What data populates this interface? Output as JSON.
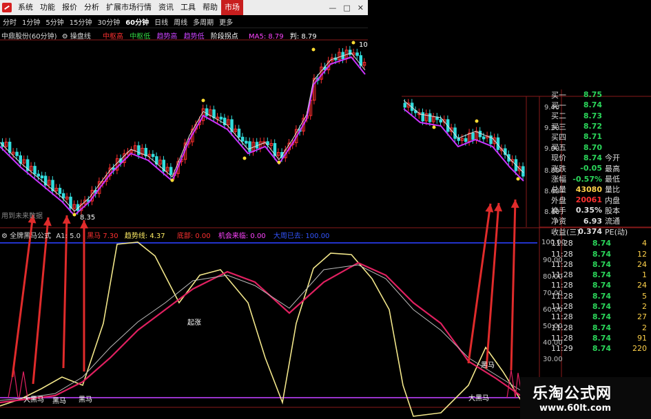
{
  "menubar": {
    "items": [
      "系统",
      "功能",
      "报价",
      "分析",
      "扩展市场行情",
      "资讯",
      "工具",
      "帮助",
      "市场"
    ],
    "active": "市场",
    "window_buttons": [
      "—",
      "□",
      "✕"
    ]
  },
  "periodbar": {
    "tabs": [
      "分时",
      "1分钟",
      "5分钟",
      "15分钟",
      "30分钟",
      "60分钟",
      "日线",
      "周线",
      "多周期",
      "更多"
    ],
    "active": "60分钟"
  },
  "main_chart": {
    "title": "中鼎股份(60分钟)",
    "subtitle": "操盘线",
    "legend": [
      {
        "label": "中枢高",
        "color": "#ff3030"
      },
      {
        "label": "中枢低",
        "color": "#33dd44"
      },
      {
        "label": "趋势高",
        "color": "#cc44ff"
      },
      {
        "label": "趋势低",
        "color": "#cc44ff"
      },
      {
        "label": "阶段拐点",
        "color": "#ffffff"
      }
    ],
    "ma_label": "MA5: 8.79",
    "judge_label": "判: 8.79",
    "price_axis": [
      "9.40",
      "9.20",
      "9.00",
      "8.80",
      "8.60",
      "8.40"
    ],
    "high_marker": "10",
    "low_marker": "8.35",
    "future_note": "用到未来数据",
    "up_color": "#ff3030",
    "down_color": "#33dddd"
  },
  "sub_chart": {
    "title": "全牌黑马公式",
    "a1": "A1: 5.0",
    "mid_label": "黑马",
    "mid_value": "7.30",
    "trend_label": "趋势线: 4.37",
    "bottom_label": "底部: 0.00",
    "chance_label": "机会来临: 0.00",
    "peak_label": "大周已去: 100.00",
    "axis": [
      "100.00",
      "90.00",
      "80.00",
      "70.00",
      "60.00",
      "50.00",
      "40.00",
      "30.00"
    ],
    "annotations": [
      "大黑马",
      "黑马",
      "黑马",
      "起涨",
      "黑马",
      "大黑马"
    ]
  },
  "quote": {
    "rows": [
      {
        "label": "买一",
        "value": "8.75",
        "color": "#2bd65a",
        "ext": ""
      },
      {
        "label": "买一",
        "value": "8.74",
        "color": "#2bd65a",
        "ext": ""
      },
      {
        "label": "买二",
        "value": "8.73",
        "color": "#2bd65a",
        "ext": ""
      },
      {
        "label": "买三",
        "value": "8.72",
        "color": "#2bd65a",
        "ext": ""
      },
      {
        "label": "买四",
        "value": "8.71",
        "color": "#2bd65a",
        "ext": ""
      },
      {
        "label": "买五",
        "value": "8.70",
        "color": "#2bd65a",
        "ext": ""
      },
      {
        "label": "现价",
        "value": "8.74",
        "color": "#2bd65a",
        "ext": "今开"
      },
      {
        "label": "涨跌",
        "value": "-0.05",
        "color": "#2bd65a",
        "ext": "最高"
      },
      {
        "label": "涨幅",
        "value": "-0.57%",
        "color": "#2bd65a",
        "ext": "最低"
      },
      {
        "label": "总量",
        "value": "43080",
        "color": "#ffd24a",
        "ext": "量比"
      },
      {
        "label": "外盘",
        "value": "20061",
        "color": "#ff3030",
        "ext": "内盘"
      },
      {
        "label": "换手",
        "value": "0.35%",
        "color": "#e0e0e0",
        "ext": "股本"
      },
      {
        "label": "净资",
        "value": "6.93",
        "color": "#e0e0e0",
        "ext": "流通"
      },
      {
        "label": "收益(三)",
        "value": "0.374",
        "color": "#e0e0e0",
        "ext": "PE(动)"
      }
    ],
    "ticks": [
      {
        "time": "11:28",
        "price": "8.74",
        "vol": "4"
      },
      {
        "time": "11:28",
        "price": "8.74",
        "vol": "12"
      },
      {
        "time": "11:28",
        "price": "8.74",
        "vol": "24"
      },
      {
        "time": "11:28",
        "price": "8.74",
        "vol": "1"
      },
      {
        "time": "11:28",
        "price": "8.74",
        "vol": "24"
      },
      {
        "time": "11:28",
        "price": "8.74",
        "vol": "5"
      },
      {
        "time": "11:28",
        "price": "8.74",
        "vol": "2"
      },
      {
        "time": "11:28",
        "price": "8.74",
        "vol": "27"
      },
      {
        "time": "11:28",
        "price": "8.74",
        "vol": "2"
      },
      {
        "time": "11:28",
        "price": "8.74",
        "vol": "91"
      },
      {
        "time": "11:29",
        "price": "8.74",
        "vol": "220"
      }
    ]
  },
  "watermark": {
    "title": "乐淘公式网",
    "url": "www.60lt.com"
  }
}
